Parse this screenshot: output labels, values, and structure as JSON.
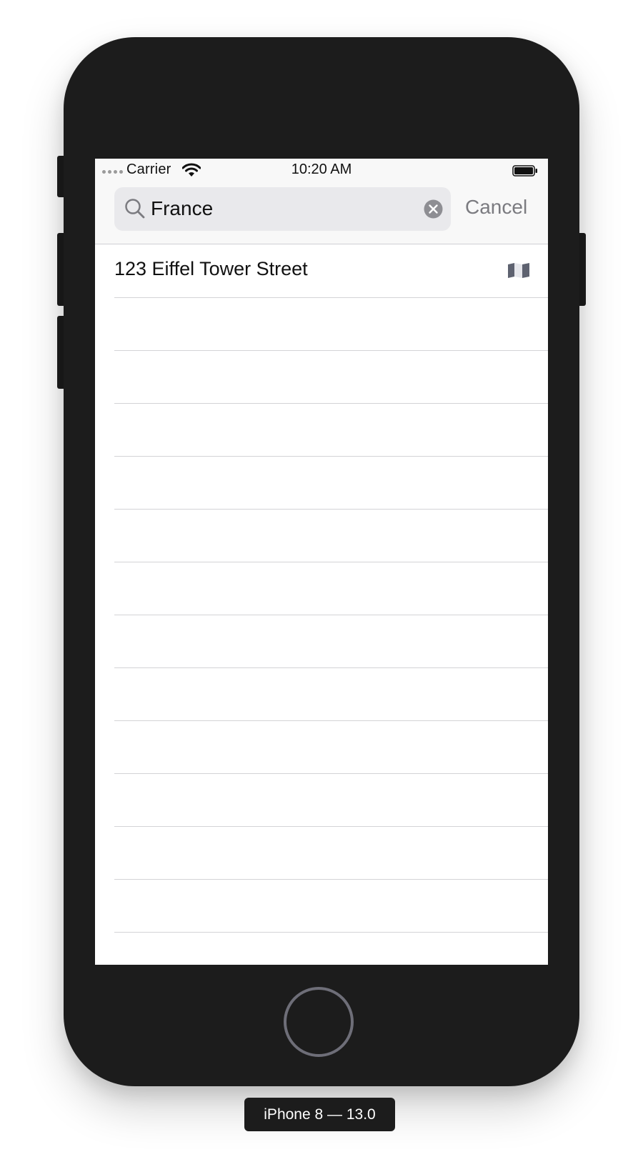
{
  "status_bar": {
    "carrier": "Carrier",
    "time": "10:20 AM",
    "signal_icon": "signal-dots-icon",
    "wifi_icon": "wifi-icon",
    "battery_icon": "battery-icon"
  },
  "search": {
    "value": "France",
    "cancel_label": "Cancel",
    "search_icon": "magnifier-icon",
    "clear_icon": "clear-circle-icon"
  },
  "results": [
    {
      "label": "123 Eiffel Tower Street",
      "icon": "map-icon"
    }
  ],
  "empty_row_count": 12,
  "device_label": "iPhone 8 — 13.0",
  "colors": {
    "device_body": "#1c1c1c",
    "header_background": "#f8f8f8",
    "search_field": "#e9e9ec",
    "cancel_text": "#7b7b80",
    "separator": "#d3d3d6"
  }
}
